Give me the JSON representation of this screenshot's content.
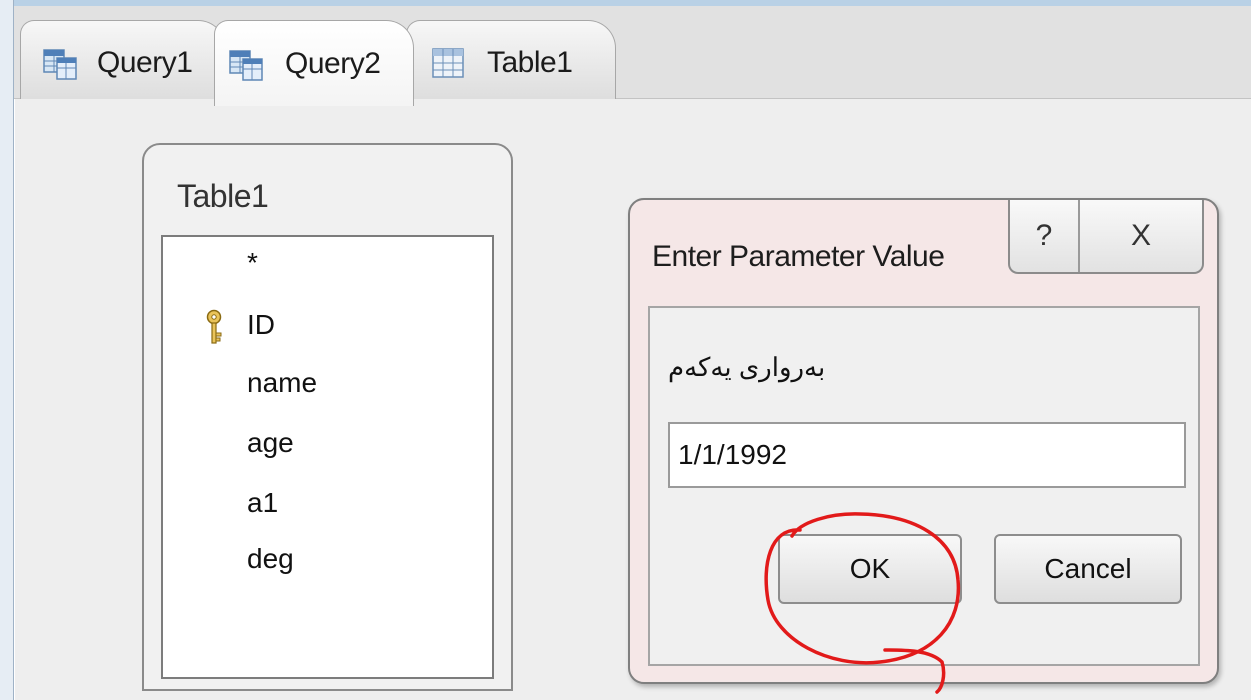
{
  "tabs": [
    {
      "label": "Query1",
      "icon": "query-icon",
      "active": false
    },
    {
      "label": "Query2",
      "icon": "query-icon",
      "active": true
    },
    {
      "label": "Table1",
      "icon": "table-icon",
      "active": false
    }
  ],
  "field_list": {
    "title": "Table1",
    "fields": [
      "*",
      "ID",
      "name",
      "age",
      "a1",
      "deg"
    ],
    "primary_key": "ID"
  },
  "dialog": {
    "title": "Enter Parameter Value",
    "help_label": "?",
    "close_label": "X",
    "prompt": "بەرواری یەکەم",
    "value": "1/1/1992",
    "ok_label": "OK",
    "cancel_label": "Cancel"
  },
  "colors": {
    "annotation": "#e21a1a",
    "dialog_background": "#f5e7e7",
    "accent_line": "#b9d1e6"
  }
}
